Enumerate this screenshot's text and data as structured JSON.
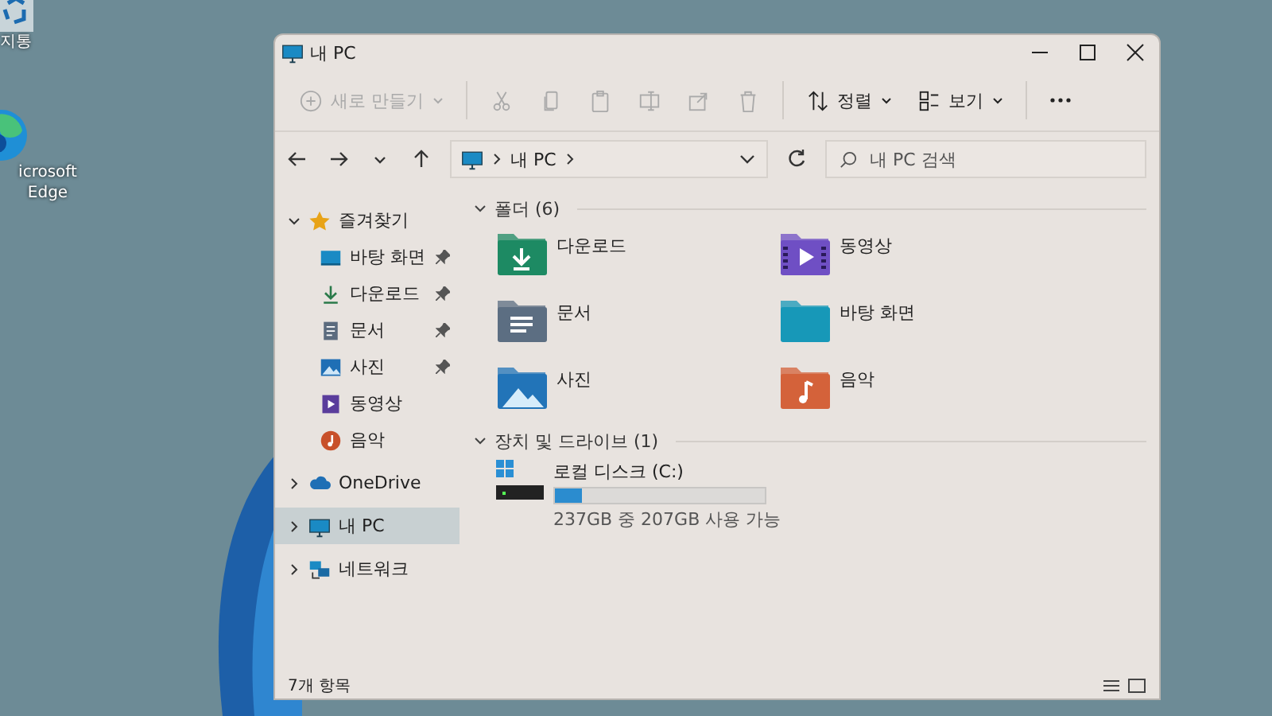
{
  "desktop": {
    "icons": [
      {
        "kind": "recycle-bin",
        "label": "지통"
      },
      {
        "kind": "edge",
        "label": "icrosoft Edge"
      }
    ]
  },
  "window": {
    "title": "내 PC"
  },
  "toolbar": {
    "items": [
      {
        "kind": "new",
        "label": "새로 만들기",
        "disabled": true
      },
      {
        "kind": "cut",
        "disabled": true
      },
      {
        "kind": "copy",
        "disabled": true
      },
      {
        "kind": "paste",
        "disabled": true
      },
      {
        "kind": "rename",
        "disabled": true
      },
      {
        "kind": "share",
        "disabled": true
      },
      {
        "kind": "delete",
        "disabled": true
      },
      {
        "kind": "sort",
        "label": "정렬",
        "disabled": false
      },
      {
        "kind": "view",
        "label": "보기",
        "disabled": false
      },
      {
        "kind": "more",
        "disabled": false
      }
    ]
  },
  "address_bar": {
    "path": [
      "내 PC"
    ]
  },
  "search": {
    "placeholder": "내 PC 검색"
  },
  "sidebar": {
    "items": [
      {
        "kind": "star",
        "label": "즐겨찾기",
        "expanded": true,
        "selected": false,
        "children": [
          {
            "kind": "desktop",
            "label": "바탕 화면",
            "pinned": true,
            "selected": false
          },
          {
            "kind": "download",
            "label": "다운로드",
            "pinned": true,
            "selected": false
          },
          {
            "kind": "document",
            "label": "문서",
            "pinned": true,
            "selected": false
          },
          {
            "kind": "picture",
            "label": "사진",
            "pinned": true,
            "selected": false
          },
          {
            "kind": "video",
            "label": "동영상",
            "pinned": false,
            "selected": false
          },
          {
            "kind": "music",
            "label": "음악",
            "pinned": false,
            "selected": false
          }
        ]
      },
      {
        "kind": "cloud",
        "label": "OneDrive",
        "expanded": false,
        "selected": false
      },
      {
        "kind": "pc",
        "label": "내 PC",
        "expanded": false,
        "selected": true
      },
      {
        "kind": "network",
        "label": "네트워크",
        "expanded": false,
        "selected": false
      }
    ]
  },
  "sections": [
    {
      "kind": "folders",
      "title": "폴더 (6)",
      "expanded": true,
      "items": [
        {
          "kind": "download",
          "label": "다운로드"
        },
        {
          "kind": "video",
          "label": "동영상"
        },
        {
          "kind": "document",
          "label": "문서"
        },
        {
          "kind": "desktop",
          "label": "바탕 화면"
        },
        {
          "kind": "picture",
          "label": "사진"
        },
        {
          "kind": "music",
          "label": "음악"
        }
      ]
    },
    {
      "kind": "drives",
      "title": "장치 및 드라이브 (1)",
      "expanded": true,
      "items": [
        {
          "label": "로컬 디스크 (C:)",
          "level": 0.13,
          "space": "237GB 중 207GB 사용 가능"
        }
      ]
    }
  ],
  "status_bar": {
    "count": "7개 항목"
  }
}
